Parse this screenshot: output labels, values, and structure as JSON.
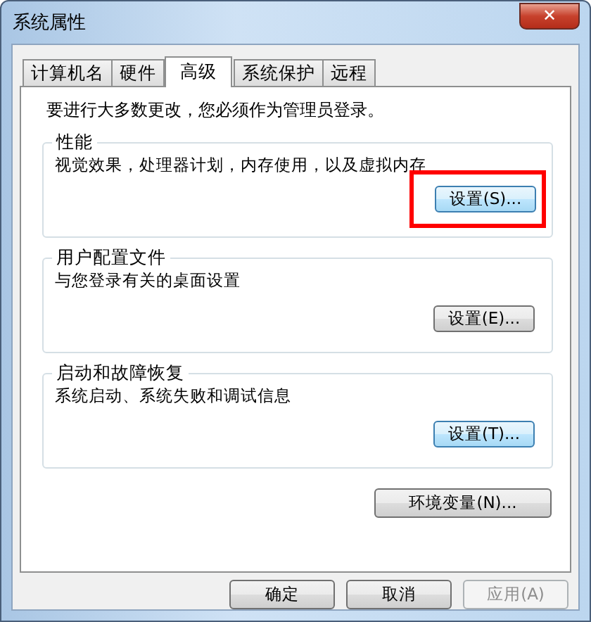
{
  "window": {
    "title": "系统属性",
    "close": "✕"
  },
  "tabs": [
    {
      "label": "计算机名",
      "selected": false
    },
    {
      "label": "硬件",
      "selected": false
    },
    {
      "label": "高级",
      "selected": true
    },
    {
      "label": "系统保护",
      "selected": false
    },
    {
      "label": "远程",
      "selected": false
    }
  ],
  "notice": "要进行大多数更改，您必须作为管理员登录。",
  "groups": [
    {
      "title": "性能",
      "description": "视觉效果，处理器计划，内存使用，以及虚拟内存",
      "button": {
        "label": "设置(S)...",
        "highlighted": true,
        "annotated": true
      }
    },
    {
      "title": "用户配置文件",
      "description": "与您登录有关的桌面设置",
      "button": {
        "label": "设置(E)...",
        "highlighted": false,
        "annotated": false
      }
    },
    {
      "title": "启动和故障恢复",
      "description": "系统启动、系统失败和调试信息",
      "button": {
        "label": "设置(T)...",
        "highlighted": true,
        "annotated": false
      }
    }
  ],
  "env_button": {
    "label": "环境变量(N)...",
    "highlighted": false
  },
  "buttons": [
    {
      "label": "确定",
      "disabled": false
    },
    {
      "label": "取消",
      "disabled": false
    },
    {
      "label": "应用(A)",
      "disabled": true
    }
  ]
}
